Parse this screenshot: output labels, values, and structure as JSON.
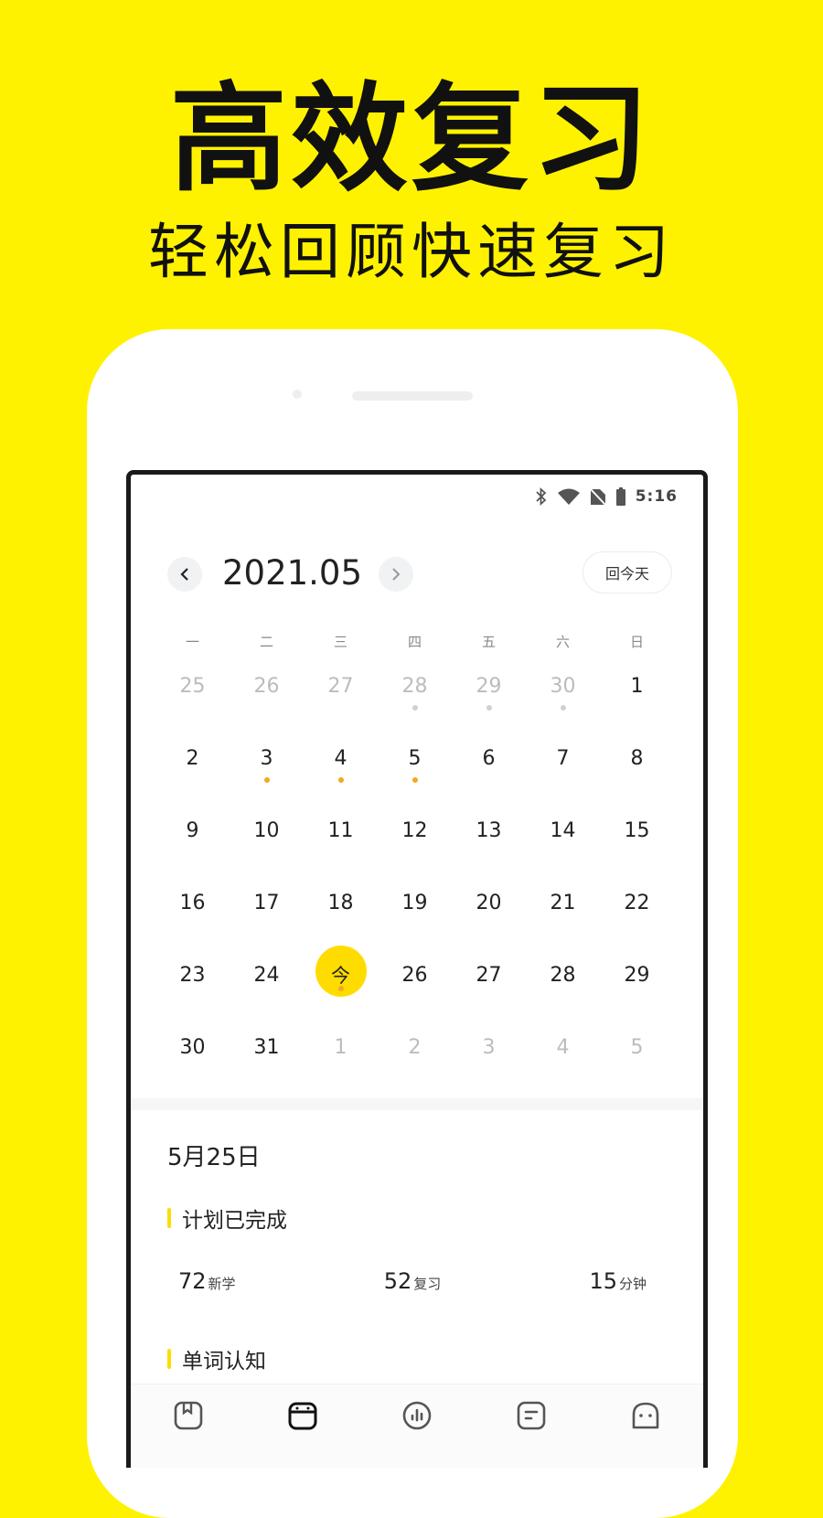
{
  "promo": {
    "title": "高效复习",
    "subtitle": "轻松回顾快速复习"
  },
  "status_bar": {
    "time": "5:16"
  },
  "calendar": {
    "month_label": "2021.05",
    "today_button": "回今天",
    "weekdays": [
      "一",
      "二",
      "三",
      "四",
      "五",
      "六",
      "日"
    ],
    "days": [
      {
        "label": "25",
        "other": true
      },
      {
        "label": "26",
        "other": true
      },
      {
        "label": "27",
        "other": true
      },
      {
        "label": "28",
        "other": true,
        "dot": "gray"
      },
      {
        "label": "29",
        "other": true,
        "dot": "gray"
      },
      {
        "label": "30",
        "other": true,
        "dot": "gray"
      },
      {
        "label": "1"
      },
      {
        "label": "2"
      },
      {
        "label": "3",
        "dot": "orange"
      },
      {
        "label": "4",
        "dot": "orange"
      },
      {
        "label": "5",
        "dot": "orange"
      },
      {
        "label": "6"
      },
      {
        "label": "7"
      },
      {
        "label": "8"
      },
      {
        "label": "9"
      },
      {
        "label": "10"
      },
      {
        "label": "11"
      },
      {
        "label": "12"
      },
      {
        "label": "13"
      },
      {
        "label": "14"
      },
      {
        "label": "15"
      },
      {
        "label": "16"
      },
      {
        "label": "17"
      },
      {
        "label": "18"
      },
      {
        "label": "19"
      },
      {
        "label": "20"
      },
      {
        "label": "21"
      },
      {
        "label": "22"
      },
      {
        "label": "23"
      },
      {
        "label": "24"
      },
      {
        "label": "今",
        "today": true,
        "dot": "orange"
      },
      {
        "label": "26"
      },
      {
        "label": "27"
      },
      {
        "label": "28"
      },
      {
        "label": "29"
      },
      {
        "label": "30"
      },
      {
        "label": "31"
      },
      {
        "label": "1",
        "other": true
      },
      {
        "label": "2",
        "other": true
      },
      {
        "label": "3",
        "other": true
      },
      {
        "label": "4",
        "other": true
      },
      {
        "label": "5",
        "other": true
      }
    ]
  },
  "detail": {
    "date": "5月25日",
    "plan_title": "计划已完成",
    "stats": [
      {
        "value": "72",
        "unit": "新学"
      },
      {
        "value": "52",
        "unit": "复习"
      },
      {
        "value": "15",
        "unit": "分钟"
      }
    ],
    "word_title": "单词认知"
  },
  "colors": {
    "background": "#FFF200",
    "accent": "#FFDC00",
    "dot": "#F5A623"
  },
  "tabs": [
    "book-icon",
    "calendar-icon",
    "chart-icon",
    "notes-icon",
    "profile-icon"
  ]
}
